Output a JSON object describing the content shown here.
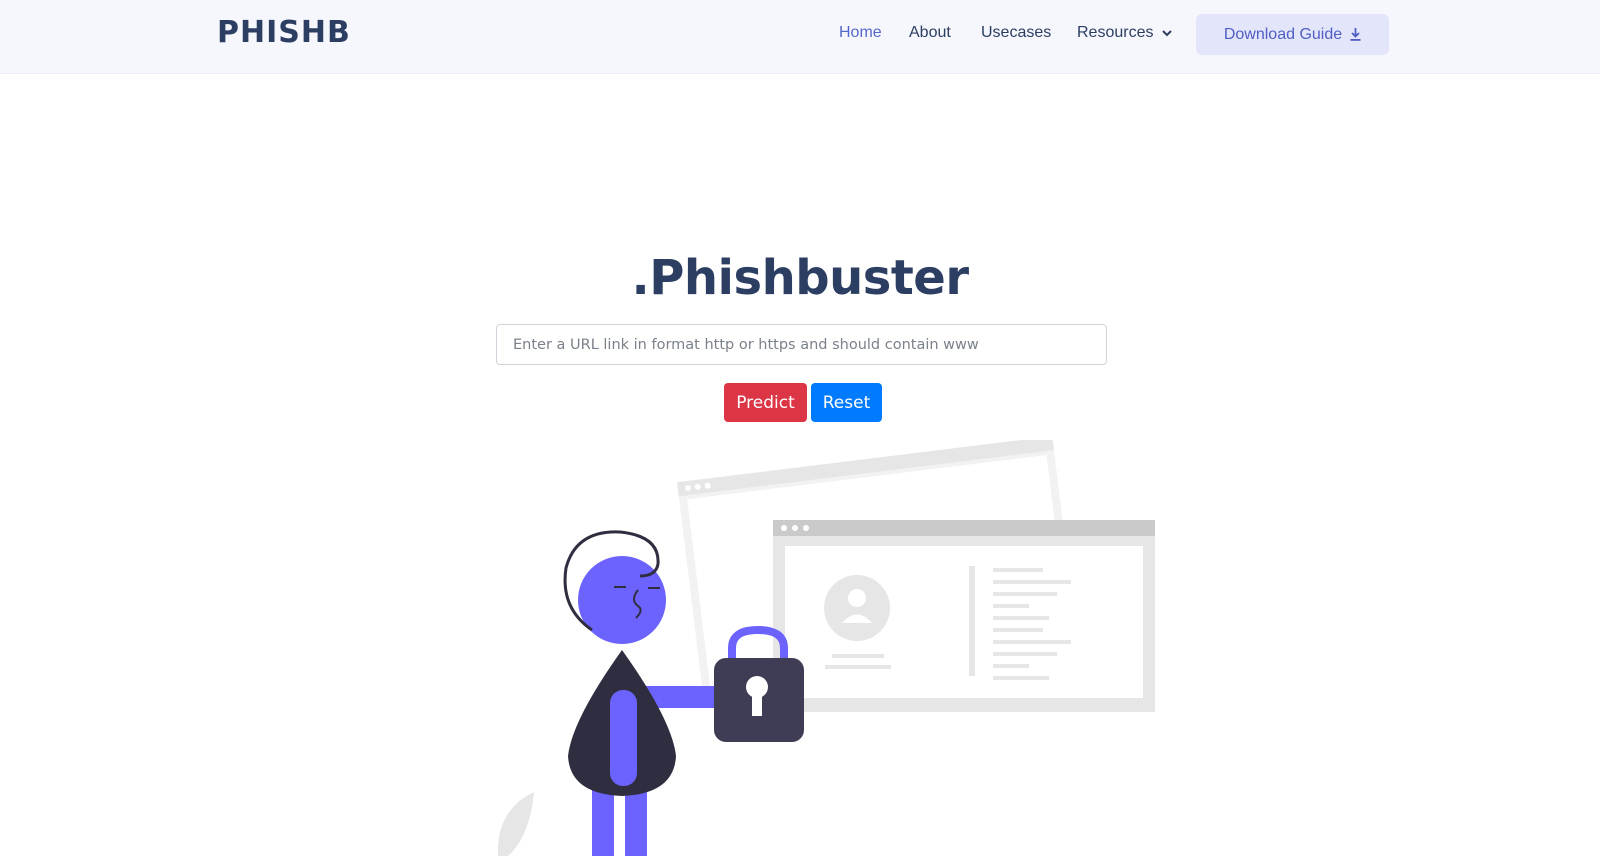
{
  "navbar": {
    "brand": "PHISHB",
    "links": [
      {
        "label": "Home",
        "active": true
      },
      {
        "label": "About"
      },
      {
        "label": "Usecases"
      },
      {
        "label": "Resources",
        "has_dropdown": true
      }
    ],
    "download_label": "Download Guide",
    "download_icon": "download-icon"
  },
  "hero": {
    "title": ".Phishbuster",
    "url_placeholder": "Enter a URL link in format http or https and should contain www",
    "url_value": "",
    "predict_label": "Predict",
    "reset_label": "Reset"
  },
  "colors": {
    "brand": "#2c3e62",
    "nav_active": "#5567cc",
    "predict": "#dc3545",
    "reset": "#007bff",
    "illustration_accent": "#6c63ff",
    "illustration_dark": "#3f3d56"
  }
}
